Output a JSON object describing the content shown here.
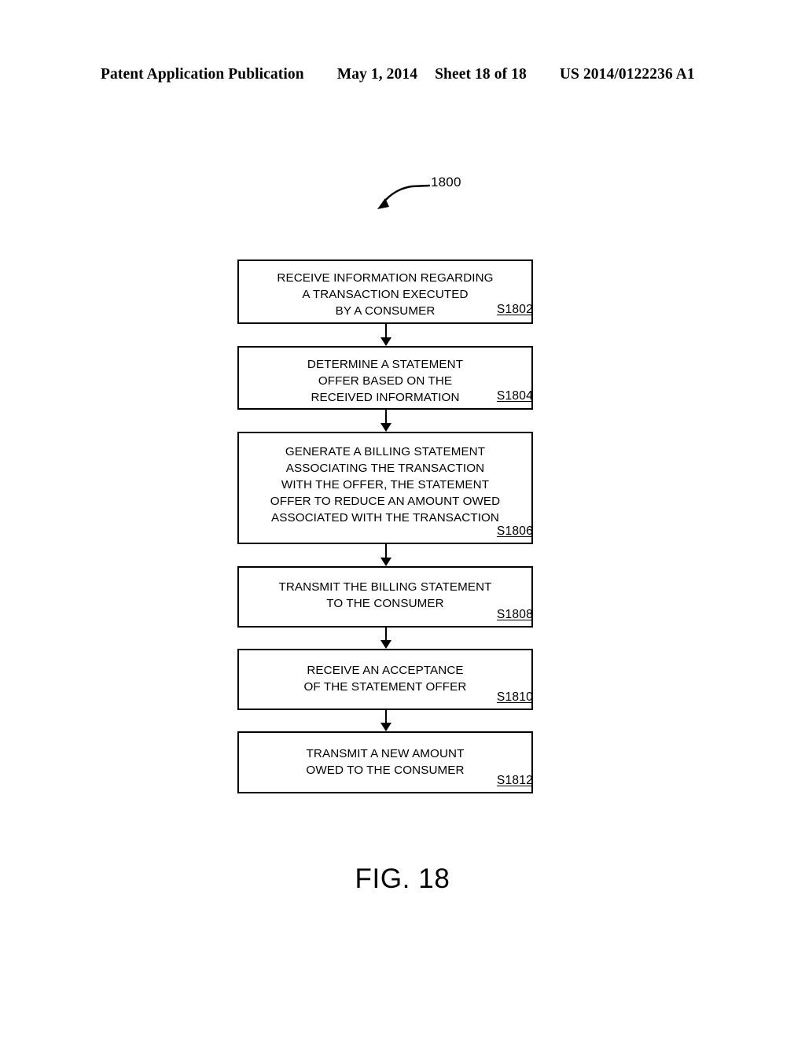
{
  "header": {
    "publication": "Patent Application Publication",
    "date": "May 1, 2014",
    "sheet": "Sheet 18 of 18",
    "patent_number": "US 2014/0122236 A1"
  },
  "figure": {
    "caption": "FIG. 18",
    "reference_numeral": "1800",
    "type": "flowchart",
    "colors": {
      "ink": "#000000",
      "background": "#ffffff"
    },
    "steps": [
      {
        "id": "S1802",
        "text": "RECEIVE INFORMATION REGARDING\nA TRANSACTION EXECUTED\nBY A CONSUMER"
      },
      {
        "id": "S1804",
        "text": "DETERMINE A STATEMENT\nOFFER BASED ON THE\nRECEIVED INFORMATION"
      },
      {
        "id": "S1806",
        "text": "GENERATE A BILLING STATEMENT\nASSOCIATING THE TRANSACTION\nWITH THE OFFER, THE STATEMENT\nOFFER TO REDUCE AN AMOUNT OWED\nASSOCIATED WITH THE TRANSACTION"
      },
      {
        "id": "S1808",
        "text": "TRANSMIT THE BILLING STATEMENT\nTO THE CONSUMER"
      },
      {
        "id": "S1810",
        "text": "RECEIVE AN ACCEPTANCE\nOF THE STATEMENT OFFER"
      },
      {
        "id": "S1812",
        "text": "TRANSMIT A NEW AMOUNT\nOWED TO THE CONSUMER"
      }
    ]
  }
}
